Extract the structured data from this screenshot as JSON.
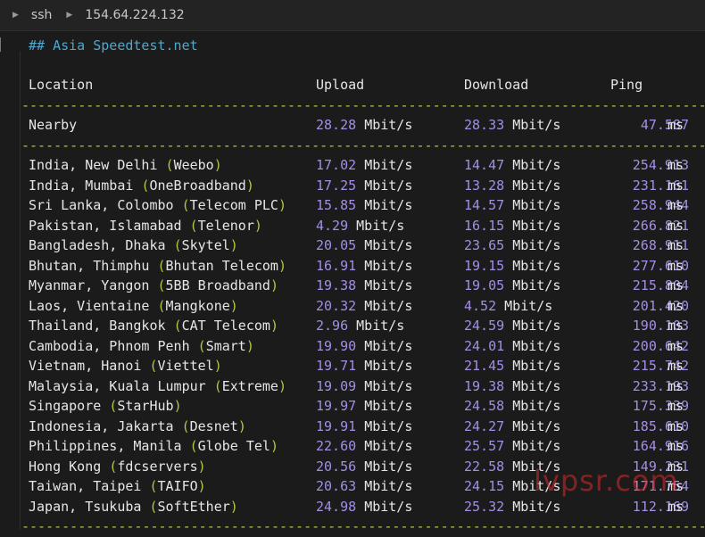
{
  "toolbar": {
    "segments": [
      "ssh",
      "154.64.224.132"
    ]
  },
  "heading": "## Asia Speedtest.net",
  "columns": {
    "location": "Location",
    "upload": "Upload",
    "download": "Download",
    "ping": "Ping"
  },
  "divider": "---------------------------------------------------------------------------------------",
  "nearby": {
    "location": "Nearby",
    "upload": "28.28",
    "download": "28.33",
    "ping": "47.587"
  },
  "unit_speed": "Mbit/s",
  "unit_ping": "ms",
  "rows": [
    {
      "place": "India, New Delhi",
      "provider": "Weebo",
      "upload": "17.02",
      "download": "14.47",
      "ping": "254.913"
    },
    {
      "place": "India, Mumbai",
      "provider": "OneBroadband",
      "upload": "17.25",
      "download": "13.28",
      "ping": "231.161"
    },
    {
      "place": "Sri Lanka, Colombo",
      "provider": "Telecom PLC",
      "upload": "15.85",
      "download": "14.57",
      "ping": "258.944"
    },
    {
      "place": "Pakistan, Islamabad",
      "provider": "Telenor",
      "upload": "4.29",
      "download": "16.15",
      "ping": "266.821"
    },
    {
      "place": "Bangladesh, Dhaka",
      "provider": "Skytel",
      "upload": "20.05",
      "download": "23.65",
      "ping": "268.911"
    },
    {
      "place": "Bhutan, Thimphu",
      "provider": "Bhutan Telecom",
      "upload": "16.91",
      "download": "19.15",
      "ping": "277.610"
    },
    {
      "place": "Myanmar, Yangon",
      "provider": "5BB Broadband",
      "upload": "19.38",
      "download": "19.05",
      "ping": "215.804"
    },
    {
      "place": "Laos, Vientaine",
      "provider": "Mangkone",
      "upload": "20.32",
      "download": "4.52",
      "ping": "201.420"
    },
    {
      "place": "Thailand, Bangkok",
      "provider": "CAT Telecom",
      "upload": "2.96",
      "download": "24.59",
      "ping": "190.103"
    },
    {
      "place": "Cambodia, Phnom Penh",
      "provider": "Smart",
      "upload": "19.90",
      "download": "24.01",
      "ping": "200.642"
    },
    {
      "place": "Vietnam, Hanoi",
      "provider": "Viettel",
      "upload": "19.71",
      "download": "21.45",
      "ping": "215.742"
    },
    {
      "place": "Malaysia, Kuala Lumpur",
      "provider": "Extreme",
      "upload": "19.09",
      "download": "19.38",
      "ping": "233.193"
    },
    {
      "place": "Singapore",
      "provider": "StarHub",
      "upload": "19.97",
      "download": "24.58",
      "ping": "175.339"
    },
    {
      "place": "Indonesia, Jakarta",
      "provider": "Desnet",
      "upload": "19.91",
      "download": "24.27",
      "ping": "185.610"
    },
    {
      "place": "Philippines, Manila",
      "provider": "Globe Tel",
      "upload": "22.60",
      "download": "25.57",
      "ping": "164.916"
    },
    {
      "place": "Hong Kong",
      "provider": "fdcservers",
      "upload": "20.56",
      "download": "22.58",
      "ping": "149.231"
    },
    {
      "place": "Taiwan, Taipei",
      "provider": "TAIFO",
      "upload": "20.63",
      "download": "24.15",
      "ping": "171.754"
    },
    {
      "place": "Japan, Tsukuba",
      "provider": "SoftEther",
      "upload": "24.98",
      "download": "25.32",
      "ping": "112.169"
    }
  ],
  "watermark": "lvpsr.com",
  "colors": {
    "background": "#1b1b1b",
    "heading": "#4fa7cc",
    "number": "#a48ee6",
    "provider": "#b5c642",
    "divider": "#b5c642",
    "text": "#e6e6e6"
  }
}
